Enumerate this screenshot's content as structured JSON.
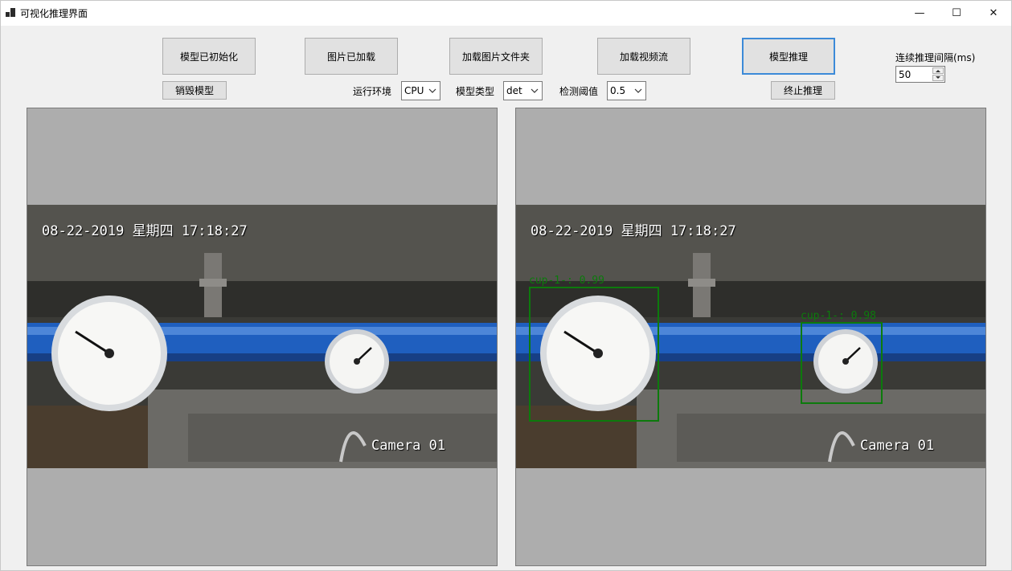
{
  "window": {
    "title": "可视化推理界面",
    "min_glyph": "—",
    "max_glyph": "☐",
    "close_glyph": "✕"
  },
  "toolbar": {
    "init_model_button": "模型已初始化",
    "load_image_button": "图片已加载",
    "load_folder_button": "加载图片文件夹",
    "load_video_button": "加载视频流",
    "infer_button": "模型推理",
    "destroy_model_button": "销毁模型",
    "stop_infer_button": "终止推理",
    "run_env_label": "运行环境",
    "run_env_value": "CPU",
    "model_type_label": "模型类型",
    "model_type_value": "det",
    "threshold_label": "检测阈值",
    "threshold_value": "0.5",
    "interval_label": "连续推理间隔(ms)",
    "interval_value": "50"
  },
  "source_view": {
    "timestamp": "08-22-2019 星期四 17:18:27",
    "camera": "Camera 01"
  },
  "result_view": {
    "timestamp": "08-22-2019 星期四 17:18:27",
    "camera": "Camera 01",
    "detections": [
      {
        "label": "cup-1-: 0.99"
      },
      {
        "label": "cup-1-: 0.98"
      }
    ]
  },
  "colors": {
    "accent": "#3c8ad8",
    "detection": "#0c7a0c",
    "pipe": "#1f5fbf",
    "panel_bg": "#adadad"
  }
}
